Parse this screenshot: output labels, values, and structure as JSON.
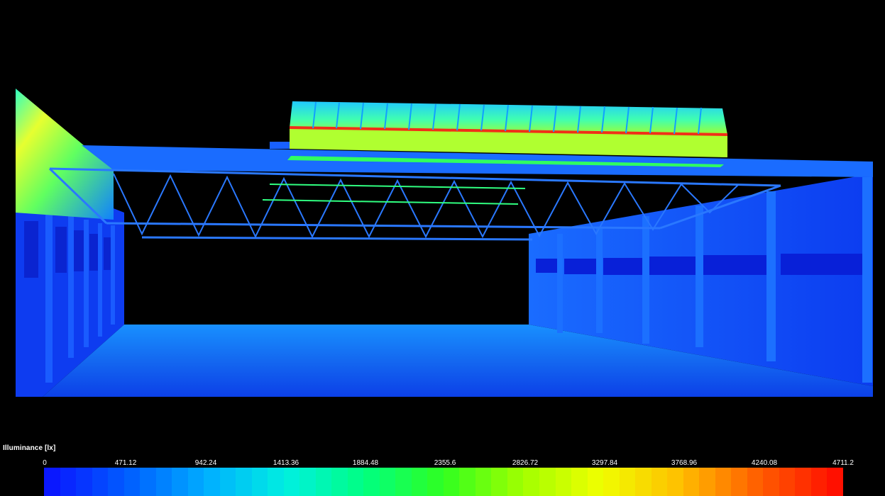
{
  "legend": {
    "title": "Illuminance [lx]",
    "ticks": [
      "0",
      "471.12",
      "942.24",
      "1413.36",
      "1884.48",
      "2355.6",
      "2826.72",
      "3297.84",
      "3768.96",
      "4240.08",
      "4711.2"
    ],
    "min": 0,
    "max": 4711.2,
    "gradient_colors": [
      "#0a18ff",
      "#0060ff",
      "#00b0ff",
      "#00f0e0",
      "#00ff80",
      "#30ff20",
      "#a0ff00",
      "#f0ff00",
      "#ffc000",
      "#ff6000",
      "#ff1000"
    ]
  },
  "scene": {
    "background": "#000000",
    "palette": {
      "floor": "#0f58e0",
      "wall": "#1040ef",
      "roof_top": "#1a6cff",
      "skylight_glass": "#2fd8ff",
      "skylight_hot": "#f03018",
      "gable_high": "#e6ff30",
      "gable_mid": "#40ffb0",
      "truss": "#2a78ff"
    }
  }
}
